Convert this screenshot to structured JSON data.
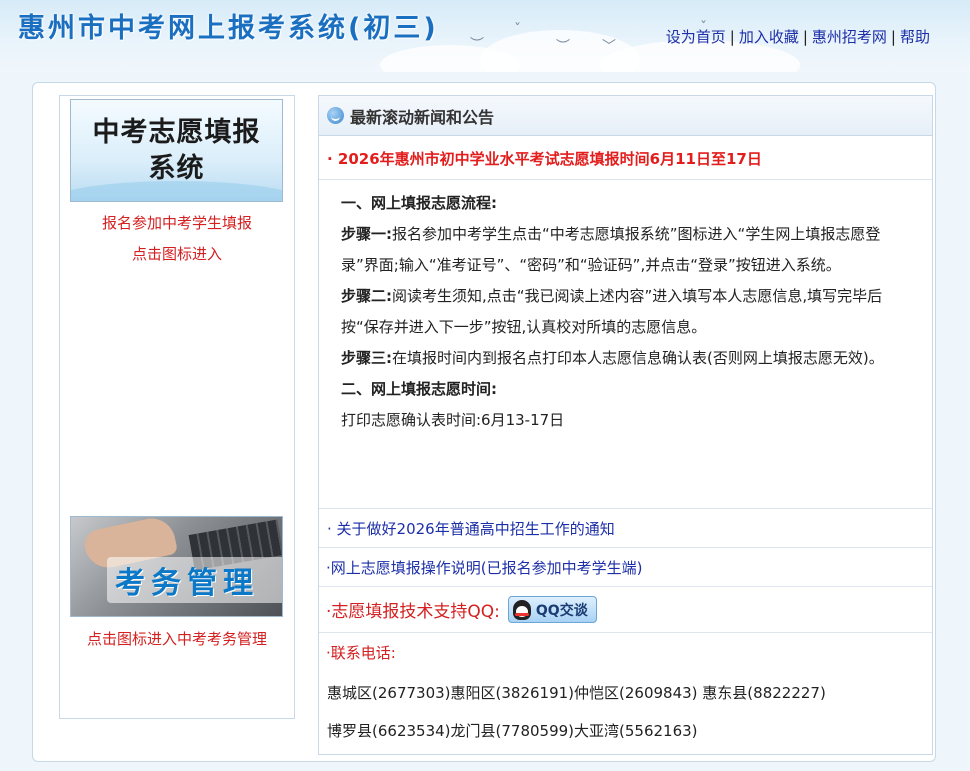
{
  "header": {
    "site_title": "惠州市中考网上报考系统(初三)",
    "links": {
      "set_home": "设为首页",
      "favorite": "加入收藏",
      "recruit_site": "惠州招考网",
      "help": "帮助"
    },
    "separator": "|"
  },
  "sidebar": {
    "zk_banner_line1": "中考志愿填报",
    "zk_banner_line2": "系统",
    "zk_caption_line1": "报名参加中考学生填报",
    "zk_caption_line2": "点击图标进入",
    "kw_banner_text": "考务管理",
    "kw_caption": "点击图标进入中考考务管理"
  },
  "news": {
    "header_title": "最新滚动新闻和公告",
    "headline": "· 2026年惠州市初中学业水平考试志愿填报时间6月11日至17日",
    "detail": {
      "section1_title": "一、网上填报志愿流程:",
      "step1_label": "步骤一:",
      "step1_text": "报名参加中考学生点击“中考志愿填报系统”图标进入“学生网上填报志愿登录”界面;输入“准考证号”、“密码”和“验证码”,并点击“登录”按钮进入系统。",
      "step2_label": "步骤二:",
      "step2_text": "阅读考生须知,点击“我已阅读上述内容”进入填写本人志愿信息,填写完毕后按“保存并进入下一步”按钮,认真校对所填的志愿信息。",
      "step3_label": "步骤三:",
      "step3_text": "在填报时间内到报名点打印本人志愿信息确认表(否则网上填报志愿无效)。",
      "section2_title": "二、网上填报志愿时间:",
      "print_time": "打印志愿确认表时间:6月13-17日"
    },
    "link_notice": "· 关于做好2026年普通高中招生工作的通知",
    "link_guide": "·网上志愿填报操作说明(已报名参加中考学生端)",
    "qq_support_label": "·志愿填报技术支持QQ:",
    "qq_button": "QQ交谈",
    "contact_label": "·联系电话:",
    "phones_line1": "惠城区(2677303)惠阳区(3826191)仲恺区(2609843) 惠东县(8822227)",
    "phones_line2": "博罗县(6623534)龙门县(7780599)大亚湾(5562163)"
  }
}
